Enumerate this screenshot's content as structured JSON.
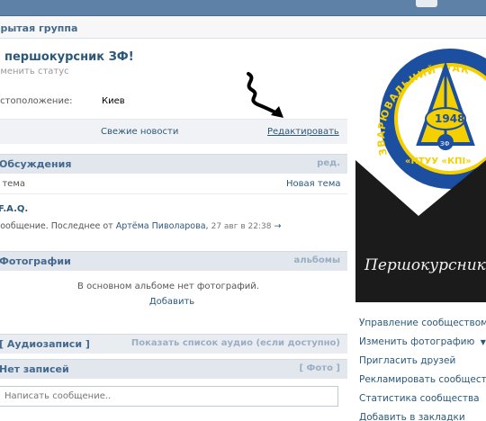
{
  "group": {
    "type_label": "крытая группа",
    "title": "l першокурсник ЗФ!",
    "status_placeholder": "зменить статус",
    "info": {
      "location_label": "естоположение:",
      "location_value": "Киев"
    }
  },
  "actions": {
    "news": "Свежие новости",
    "edit": "Редактировать"
  },
  "discussions": {
    "header": "Обсуждения",
    "header_right": "ред.",
    "count": ". тема",
    "new_topic": "Новая тема",
    "topic": {
      "title": "F.A.Q.",
      "last_prefix": "сообщение. Последнее от",
      "last_author": "Артёма Пиволарова,",
      "last_date": "27 авг в 22:38",
      "arrow": "→"
    }
  },
  "photos": {
    "header": "Фотографии",
    "header_right": "альбомы",
    "empty": "В основном альбоме нет фотографий.",
    "add": "Добавить"
  },
  "audio": {
    "header": "[ Аудиозаписи ]",
    "header_right": "Показать список аудио (если доступно)"
  },
  "wall": {
    "header": "Нет записей",
    "header_right": "[ Фото ]",
    "input_placeholder": "Написать сообщение.."
  },
  "avatar": {
    "emblem_ring_text": "ЗВАРЮВАЛЬНИЙ ФАК",
    "emblem_year": "1948",
    "emblem_bottom": "«НТУУ «КПІ»",
    "emblem_small": "ЗФ",
    "banner_text": "Першокурсник"
  },
  "menu": [
    "Управление сообществом",
    "Изменить фотографию",
    "Пригласить друзей",
    "Рекламировать сообщество",
    "Статистика сообщества",
    "Добавить в закладки"
  ],
  "menu_dropdown_icon": "▼",
  "colors": {
    "link": "#2b587a",
    "header_bg": "#e1e7ed",
    "topbar": "#5e81a8",
    "emblem_blue": "#1d4fa0",
    "emblem_yellow": "#f5d000"
  }
}
